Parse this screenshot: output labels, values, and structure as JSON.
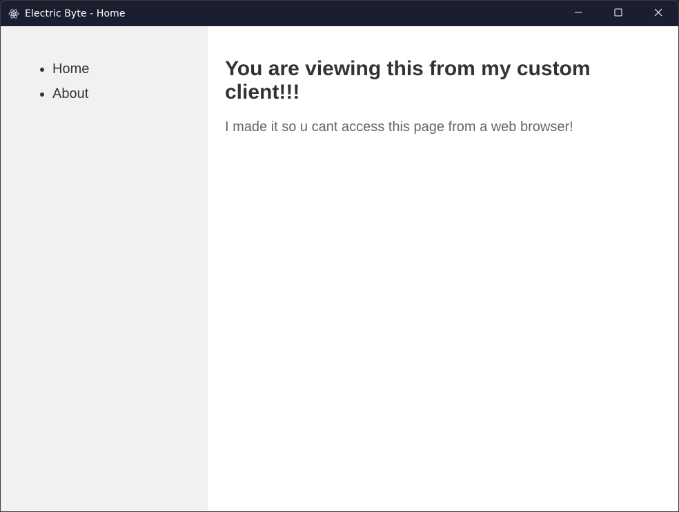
{
  "window": {
    "title": "Electric Byte - Home",
    "icon": "electron-atom-icon",
    "controls": [
      "minimize-icon",
      "maximize-icon",
      "close-icon"
    ]
  },
  "sidebar": {
    "items": [
      {
        "label": "Home"
      },
      {
        "label": "About"
      }
    ]
  },
  "main": {
    "heading": "You are viewing this from my custom client!!!",
    "message": "I made it so u cant access this page from a web browser!"
  },
  "colors": {
    "titlebar": "#1b1e2e",
    "sidebar": "#f1f1f1",
    "heading": "#333333",
    "message": "#666666"
  }
}
